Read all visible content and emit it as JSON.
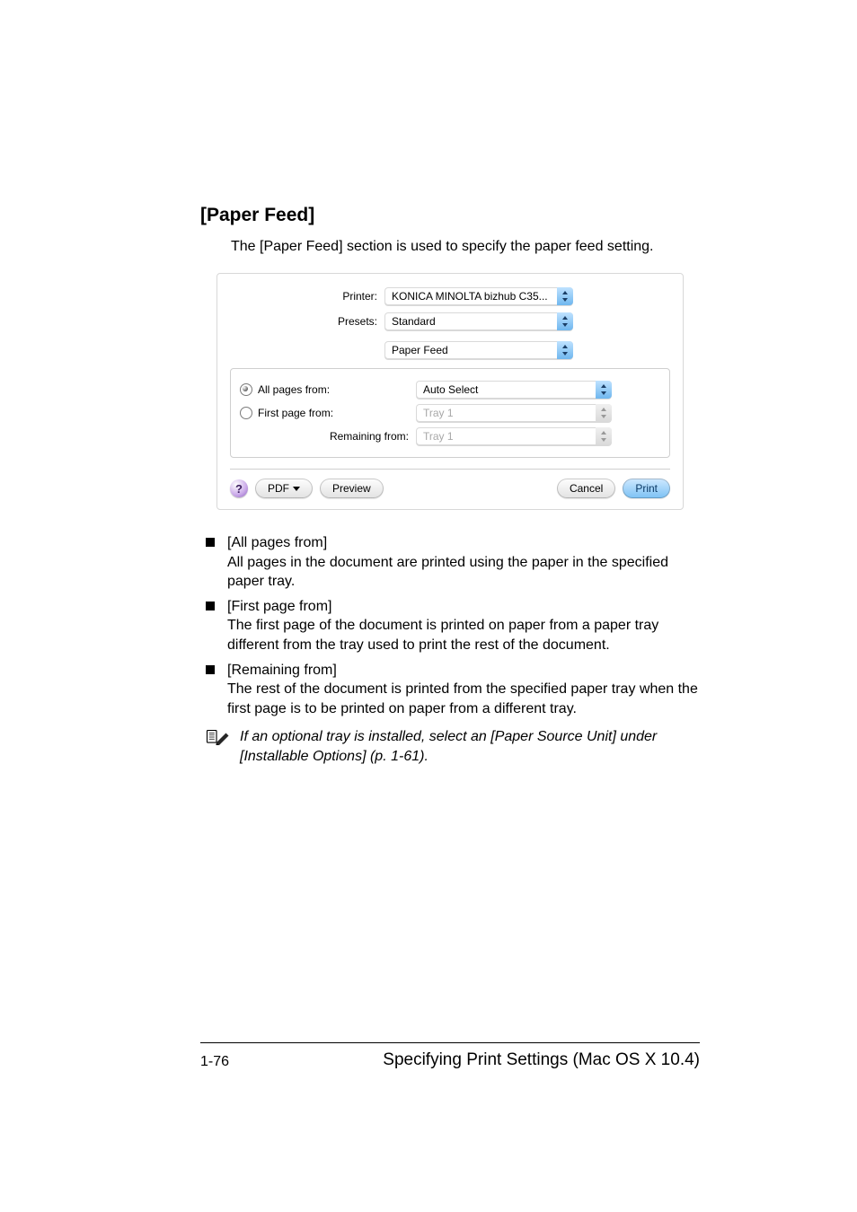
{
  "heading": "[Paper Feed]",
  "intro": "The [Paper Feed] section is used to specify the paper feed setting.",
  "dialog": {
    "printer_label": "Printer:",
    "printer_value": "KONICA MINOLTA bizhub C35...",
    "presets_label": "Presets:",
    "presets_value": "Standard",
    "panel_value": "Paper Feed",
    "all_pages_label": "All pages from:",
    "all_pages_value": "Auto Select",
    "first_page_label": "First page from:",
    "first_page_value": "Tray 1",
    "remaining_label": "Remaining from:",
    "remaining_value": "Tray 1",
    "help_glyph": "?",
    "pdf_label": "PDF",
    "preview_label": "Preview",
    "cancel_label": "Cancel",
    "print_label": "Print"
  },
  "bullets": [
    {
      "label": "[All pages from]",
      "desc": "All pages in the document are printed using the paper in the specified paper tray."
    },
    {
      "label": "[First page from]",
      "desc": "The first page of the document is printed on paper from a paper tray different from the tray used to print the rest of the document."
    },
    {
      "label": "[Remaining from]",
      "desc": "The rest of the document is printed from the specified paper tray when the first page is to be printed on paper from a different tray."
    }
  ],
  "note": "If an optional tray is installed, select an [Paper Source Unit] under [Installable Options] (p. 1-61).",
  "footer": {
    "page": "1-76",
    "title": "Specifying Print Settings (Mac OS X 10.4)"
  }
}
